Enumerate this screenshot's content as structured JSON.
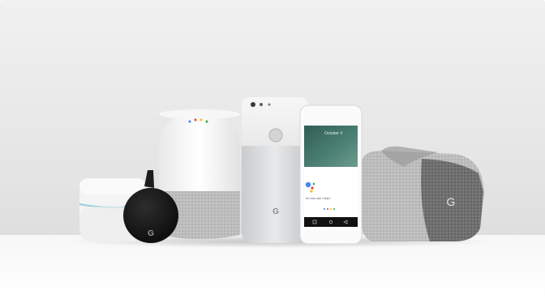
{
  "scene": {
    "colors": {
      "backdrop_top": "#efefef",
      "backdrop_bottom": "#e2e2e2",
      "surface": "#f6f6f6",
      "device_white": "#f3f3f3",
      "device_silver": "#cfd1d3",
      "fabric_grey": "#6b6b6b",
      "puck_black": "#151515",
      "assistant_blue": "#4285f4",
      "assistant_red": "#ea4335",
      "assistant_yellow": "#fbbc05",
      "assistant_green": "#34a853",
      "wallpaper_teal": "#3a6e63"
    },
    "icons": [
      "google-g-logo",
      "google-assistant-dots"
    ],
    "phone_screen": {
      "time": "October 4",
      "assistant_prompt": "Hi, how can I help?"
    },
    "logos": {
      "mark": "G"
    }
  }
}
